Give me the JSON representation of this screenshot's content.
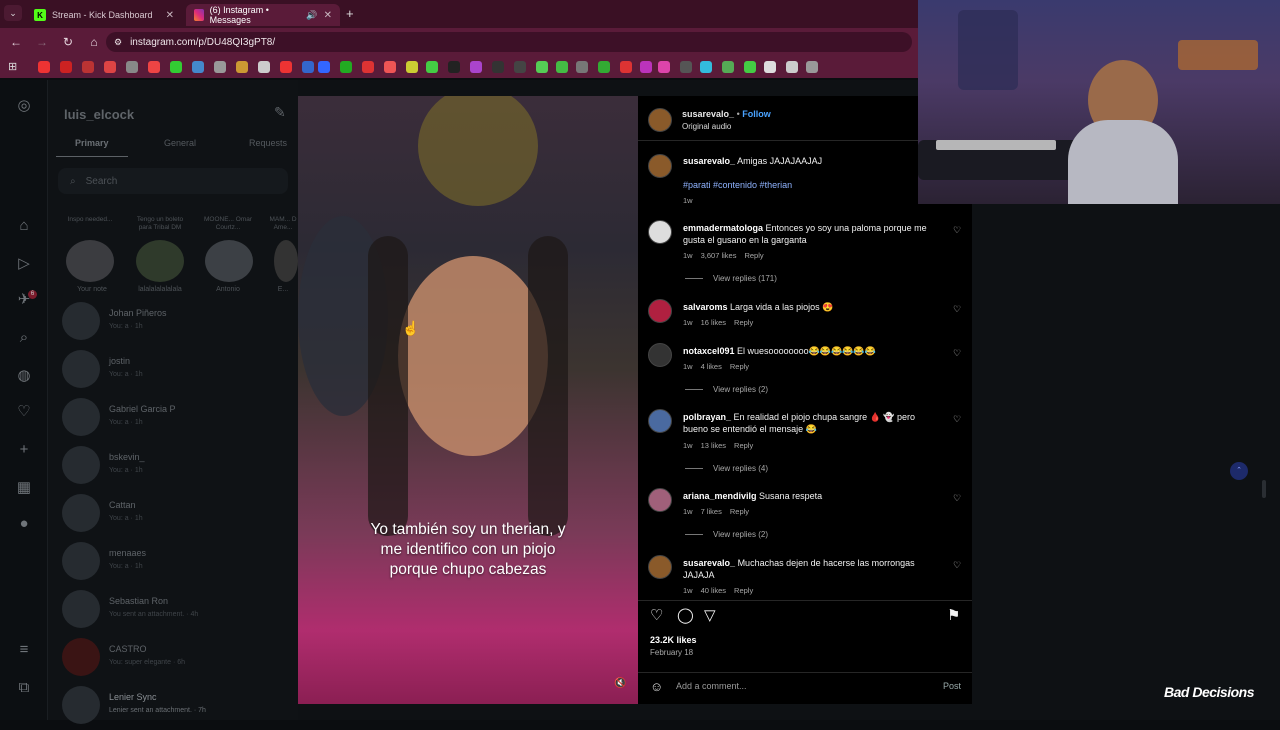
{
  "browser": {
    "tabs": [
      {
        "title": "Stream - Kick Dashboard",
        "favicon": "K",
        "active": false
      },
      {
        "title": "(6) Instagram • Messages",
        "favicon": "ig",
        "active": true
      }
    ],
    "url": "instagram.com/p/DU48QI3gPT8/"
  },
  "inbox": {
    "username": "luis_elcock",
    "tabs": [
      "Primary",
      "General",
      "Requests"
    ],
    "search_placeholder": "Search",
    "notes": [
      {
        "text": "Inspo needed...",
        "name": "Your note"
      },
      {
        "text": "Tengo un boleto para Tribal DM",
        "name": "lalalalalalalala"
      },
      {
        "text": "MOONE... Omar Courtz...",
        "name": "Antonio"
      },
      {
        "text": "MAM... D Ame...",
        "name": "E..."
      }
    ],
    "conversations": [
      {
        "name": "Johan Piñeros",
        "sub": "You: a · 1h"
      },
      {
        "name": "jostin",
        "sub": "You: a · 1h"
      },
      {
        "name": "Gabriel Garcia P",
        "sub": "You: a · 1h"
      },
      {
        "name": "bskevin_",
        "sub": "You: a · 1h"
      },
      {
        "name": "Cattan",
        "sub": "You: a · 1h"
      },
      {
        "name": "menaaes",
        "sub": "You: a · 1h"
      },
      {
        "name": "Sebastian Ron",
        "sub": "You sent an attachment. · 4h"
      },
      {
        "name": "CASTRO",
        "sub": "You: super elegante · 6h"
      },
      {
        "name": "Lenier Sync",
        "sub": "Lenier sent an attachment. · 7h"
      }
    ],
    "notification_count": "6"
  },
  "reel": {
    "caption": "Yo también soy un therian, y me identifico con un piojo porque chupo cabezas"
  },
  "post": {
    "author": "susarevalo_",
    "follow_label": "Follow",
    "audio": "Original audio",
    "caption_text": "Amigas JAJAJAAJAJ",
    "hashtags": "#parati #contenido #therian",
    "caption_age": "1w",
    "comments": [
      {
        "user": "emmadermatologa",
        "text": "Entonces yo soy una paloma porque me gusta el gusano en la garganta",
        "age": "1w",
        "likes": "3,607 likes",
        "replies": "View replies (171)"
      },
      {
        "user": "salvaroms",
        "text": "Larga vida a las piojos 😍",
        "age": "1w",
        "likes": "16 likes",
        "replies": ""
      },
      {
        "user": "notaxcel091",
        "text": "El wuesoooooooo😂😂😂😂😂😂",
        "age": "1w",
        "likes": "4 likes",
        "replies": "View replies (2)"
      },
      {
        "user": "polbrayan_",
        "text": "En realidad el piojo chupa sangre 🩸 👻 pero bueno se entendió el mensaje 😂",
        "age": "1w",
        "likes": "13 likes",
        "replies": "View replies (4)"
      },
      {
        "user": "ariana_mendivilg",
        "text": "Susana respeta",
        "age": "1w",
        "likes": "7 likes",
        "replies": "View replies (2)"
      },
      {
        "user": "susarevalo_",
        "text": "Muchachas dejen de hacerse las morrongas JAJAJA",
        "age": "1w",
        "likes": "40 likes",
        "replies": ""
      }
    ],
    "reply_label": "Reply",
    "likes_total": "23.2K likes",
    "date": "February 18",
    "comment_placeholder": "Add a comment...",
    "post_button": "Post"
  },
  "overlay": {
    "watermark": "Bad Decisions"
  }
}
